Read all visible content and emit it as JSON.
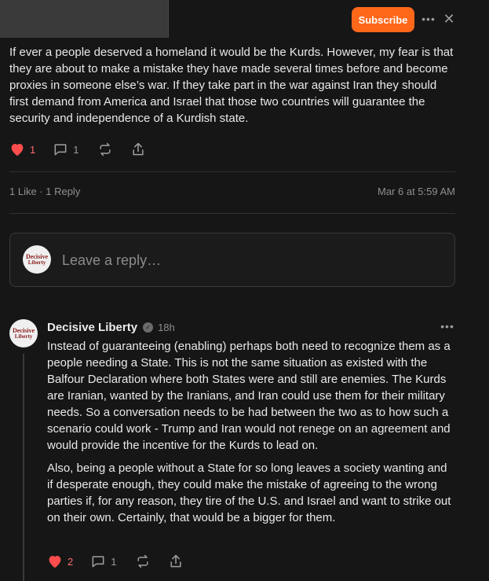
{
  "header": {
    "subscribe_label": "Subscribe",
    "more_icon": "ellipsis-icon",
    "close_icon": "close-icon"
  },
  "comment": {
    "text": "If ever a people deserved a homeland it would be the Kurds. However, my fear is that they are about to make a mistake they have made several times before and become proxies in someone else’s war. If they take part in the war against Iran they should first demand from America and Israel that those two countries will guarantee the security and independence of a Kurdish state.",
    "like_count": "1",
    "reply_count": "1",
    "likes_summary": "1 Like · 1 Reply",
    "timestamp": "Mar 6 at 5:59 AM"
  },
  "reply_box": {
    "placeholder": "Leave a reply…",
    "avatar_text_line1": "Decisive",
    "avatar_text_line2": "Liberty"
  },
  "reply": {
    "author": "Decisive Liberty",
    "time": "18h",
    "paragraphs": [
      "Instead of guaranteeing (enabling) perhaps both need to recognize them as a people needing a State. This is not the same situation as existed with the Balfour Declaration where both States were and still are enemies. The Kurds are Iranian, wanted by the Iranians, and Iran could use them for their military needs. So a conversation needs to be had between the two as to how such a scenario could work - Trump and Iran would not renege on an agreement and would provide the incentive for the Kurds to lead on.",
      "Also, being a people without a State for so long leaves a society wanting and if desperate enough, they could make the mistake of agreeing to the wrong parties if, for any reason, they tire of the U.S. and Israel and want to strike out on their own. Certainly, that would be a bigger for them."
    ],
    "like_count": "2",
    "reply_count": "1"
  },
  "colors": {
    "accent": "#ff6719",
    "heart": "#ff4d4d",
    "background": "#161616"
  }
}
